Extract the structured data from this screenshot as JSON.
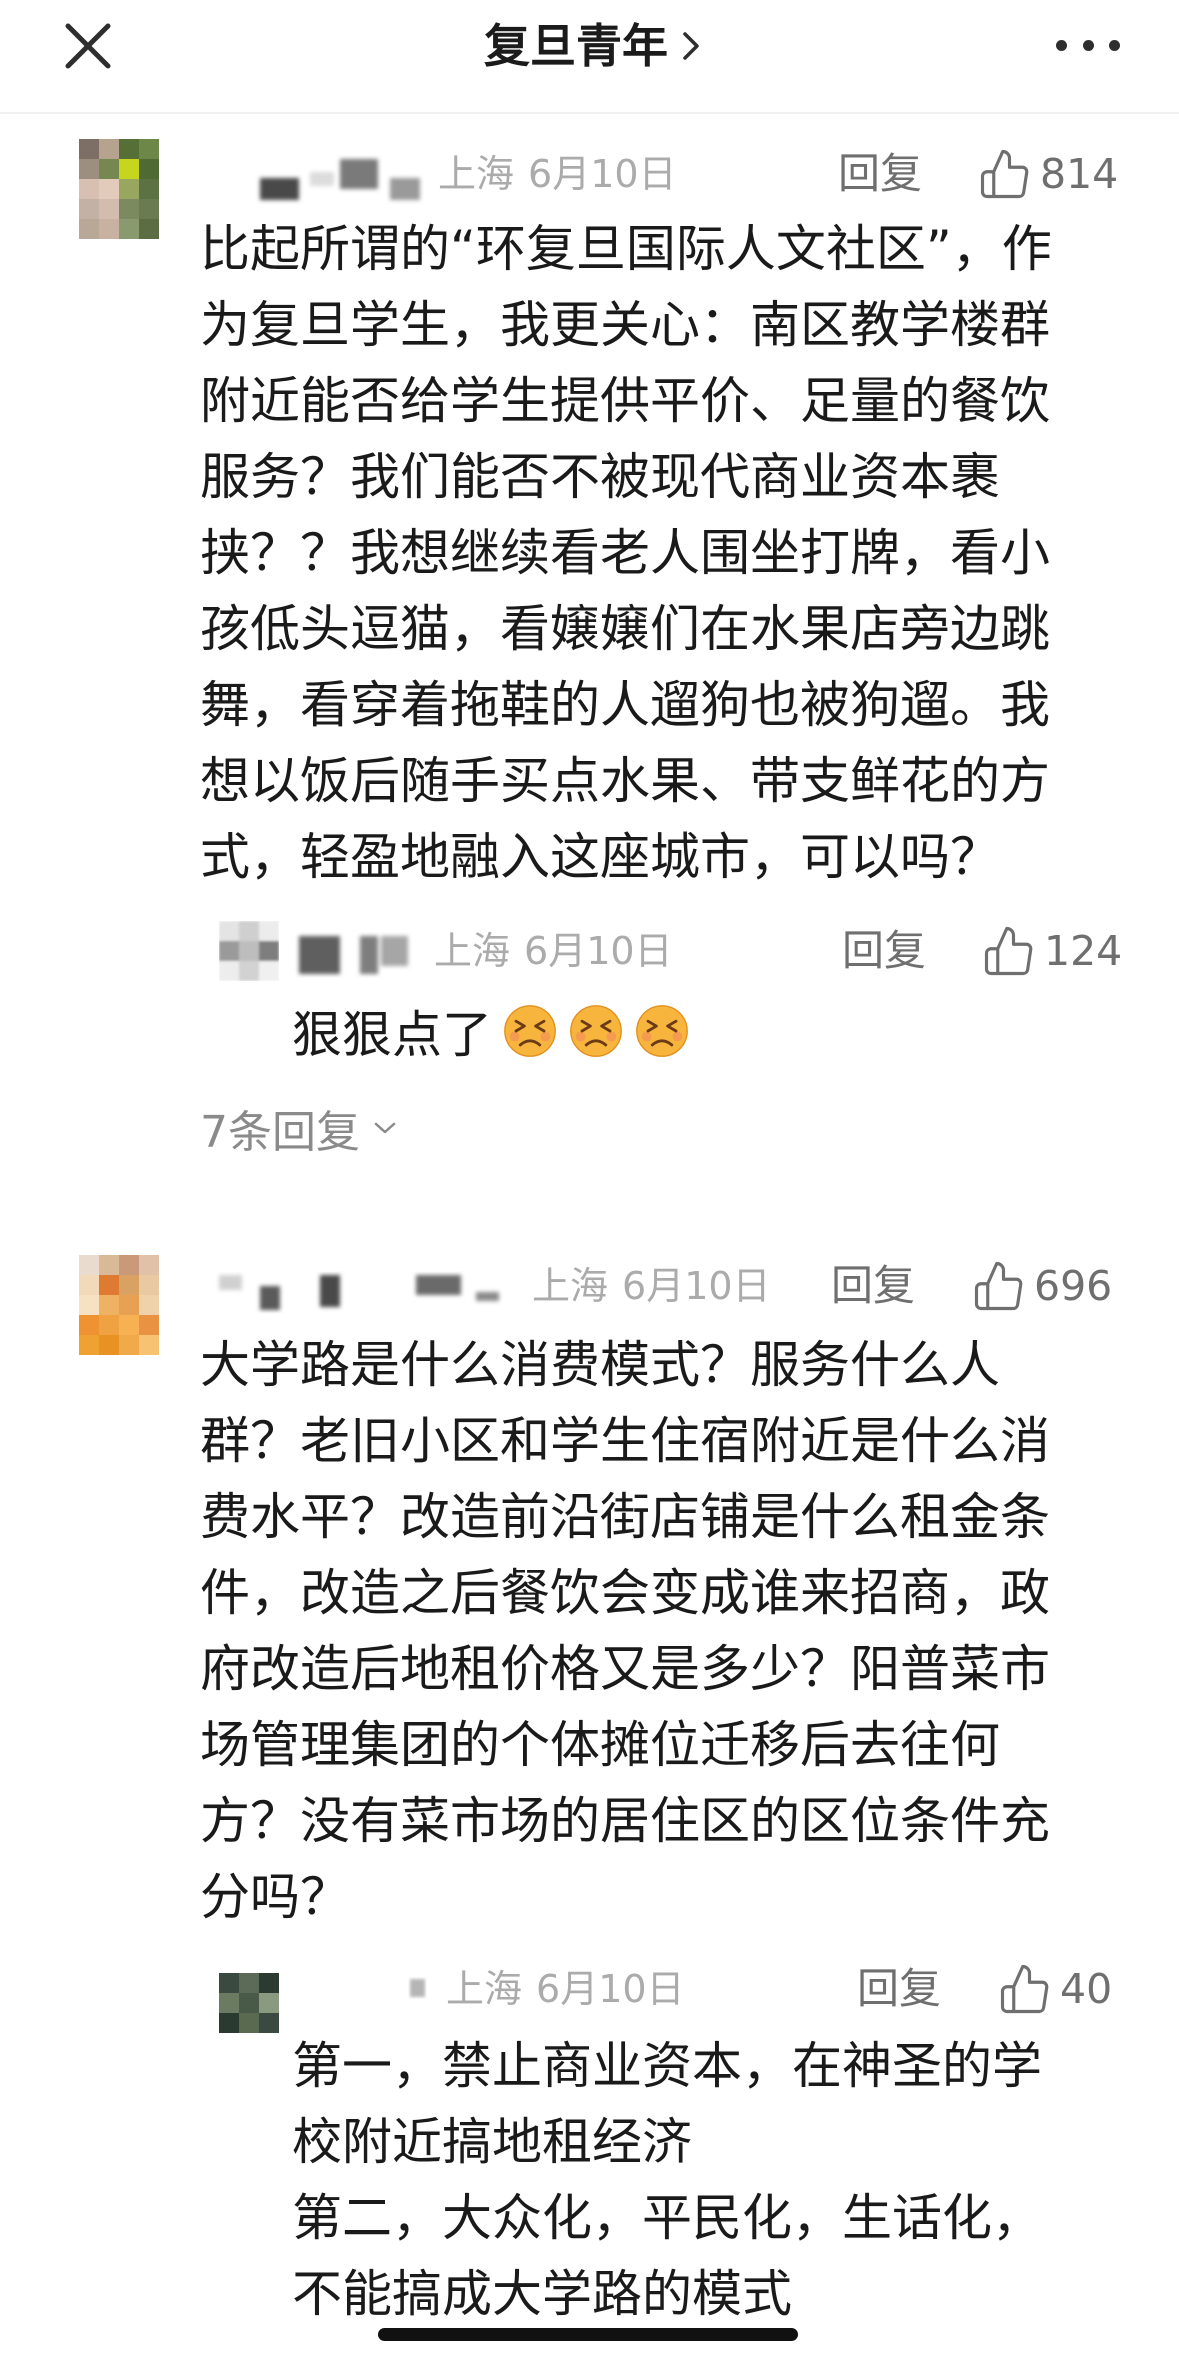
{
  "header": {
    "title": "复旦青年"
  },
  "icons": {
    "close": "close-icon",
    "title_chevron": "chevron-right-icon",
    "more": "more-icon",
    "like": "thumbs-up-icon",
    "emoji": "persevering-face-icon",
    "expand": "chevron-down-icon"
  },
  "comments": [
    {
      "location": "上海",
      "date": "6月10日",
      "reply_label": "回复",
      "likes": "814",
      "body_lines": [
        "比起所谓的“环复旦国际人文社区”，作",
        "为复旦学生，我更关心：南区教学楼群",
        "附近能否给学生提供平价、足量的餐饮",
        "服务？我们能否不被现代商业资本裹",
        "挟？？我想继续看老人围坐打牌，看小",
        "孩低头逗猫，看嬢嬢们在水果店旁边跳",
        "舞，看穿着拖鞋的人遛狗也被狗遛。我",
        "想以饭后随手买点水果、带支鲜花的方",
        "式，轻盈地融入这座城市，可以吗？"
      ],
      "replies": [
        {
          "location": "上海",
          "date": "6月10日",
          "reply_label": "回复",
          "likes": "124",
          "text": "狠狠点了",
          "emoji_icons": [
            "persevering-face-icon",
            "persevering-face-icon",
            "persevering-face-icon"
          ]
        }
      ],
      "more_replies": "7条回复"
    },
    {
      "location": "上海",
      "date": "6月10日",
      "reply_label": "回复",
      "likes": "696",
      "body_lines": [
        "大学路是什么消费模式？服务什么人",
        "群？老旧小区和学生住宿附近是什么消",
        "费水平？改造前沿街店铺是什么租金条",
        "件，改造之后餐饮会变成谁来招商，政",
        "府改造后地租价格又是多少？阳普菜市",
        "场管理集团的个体摊位迁移后去往何",
        "方？没有菜市场的居住区的区位条件充",
        "分吗？"
      ],
      "replies": [
        {
          "location": "上海",
          "date": "6月10日",
          "reply_label": "回复",
          "likes": "40",
          "text_lines": [
            "第一，禁止商业资本，在神圣的学",
            "校附近搞地租经济",
            "第二，大众化，平民化，生话化，",
            "不能搞成大学路的模式"
          ]
        }
      ]
    }
  ],
  "colors": {
    "body_text": "#1a1a1a",
    "meta_text": "#ababab",
    "action_text": "#6f6f6f",
    "emoji_face": "#f7b53e"
  }
}
